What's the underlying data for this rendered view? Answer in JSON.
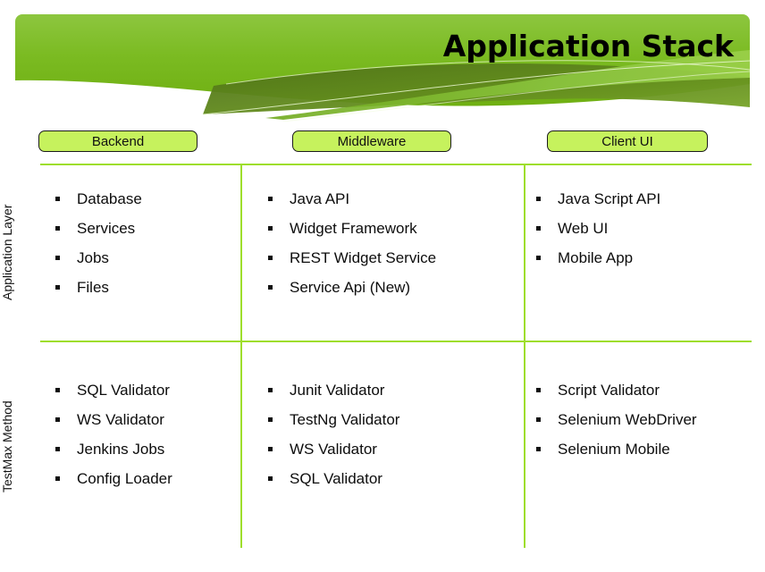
{
  "banner": {
    "title": "Application Stack",
    "colors": {
      "light_green": "#7cbd22",
      "mid_green": "#8cc63f",
      "dark_olive": "#587f1c",
      "accent_line": "#9ede2c",
      "pill_fill": "#c6f25d"
    }
  },
  "columns": [
    {
      "label": "Backend"
    },
    {
      "label": "Middleware"
    },
    {
      "label": "Client UI"
    }
  ],
  "rows": [
    {
      "side_label": "Application Layer",
      "cells": [
        {
          "items": [
            "Database",
            "Services",
            "Jobs",
            "Files"
          ]
        },
        {
          "items": [
            "Java API",
            "Widget Framework",
            "REST Widget Service",
            "Service Api (New)"
          ]
        },
        {
          "items": [
            "Java Script API",
            "Web UI",
            "Mobile App"
          ]
        }
      ]
    },
    {
      "side_label": "TestMax Method",
      "cells": [
        {
          "items": [
            "SQL Validator",
            "WS Validator",
            "Jenkins Jobs",
            "Config Loader"
          ]
        },
        {
          "items": [
            "Junit Validator",
            "TestNg Validator",
            "WS Validator",
            "SQL Validator"
          ]
        },
        {
          "items": [
            "Script Validator",
            "Selenium WebDriver",
            "Selenium Mobile"
          ]
        }
      ]
    }
  ]
}
